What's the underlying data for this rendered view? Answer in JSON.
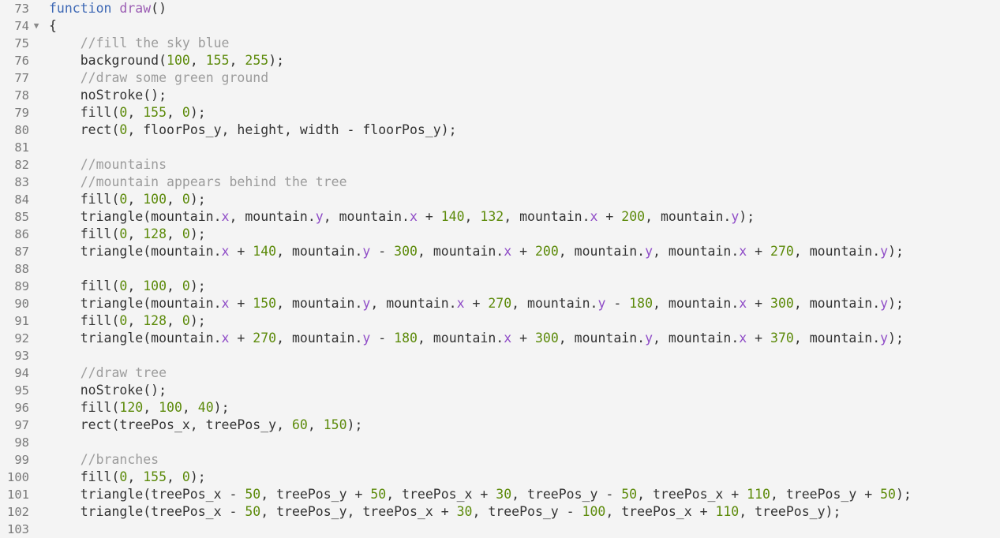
{
  "editor": {
    "fold_marker": "▼",
    "lines": [
      {
        "n": "73",
        "fold": false,
        "tokens": [
          [
            "kw",
            "function"
          ],
          [
            "plain",
            " "
          ],
          [
            "fn",
            "draw"
          ],
          [
            "plain",
            "()"
          ]
        ]
      },
      {
        "n": "74",
        "fold": true,
        "tokens": [
          [
            "plain",
            "{"
          ]
        ]
      },
      {
        "n": "75",
        "fold": false,
        "tokens": [
          [
            "plain",
            "    "
          ],
          [
            "cm",
            "//fill the sky blue"
          ]
        ]
      },
      {
        "n": "76",
        "fold": false,
        "tokens": [
          [
            "plain",
            "    background("
          ],
          [
            "num",
            "100"
          ],
          [
            "plain",
            ", "
          ],
          [
            "num",
            "155"
          ],
          [
            "plain",
            ", "
          ],
          [
            "num",
            "255"
          ],
          [
            "plain",
            ");"
          ]
        ]
      },
      {
        "n": "77",
        "fold": false,
        "tokens": [
          [
            "plain",
            "    "
          ],
          [
            "cm",
            "//draw some green ground"
          ]
        ]
      },
      {
        "n": "78",
        "fold": false,
        "tokens": [
          [
            "plain",
            "    noStroke();"
          ]
        ]
      },
      {
        "n": "79",
        "fold": false,
        "tokens": [
          [
            "plain",
            "    fill("
          ],
          [
            "num",
            "0"
          ],
          [
            "plain",
            ", "
          ],
          [
            "num",
            "155"
          ],
          [
            "plain",
            ", "
          ],
          [
            "num",
            "0"
          ],
          [
            "plain",
            ");"
          ]
        ]
      },
      {
        "n": "80",
        "fold": false,
        "tokens": [
          [
            "plain",
            "    rect("
          ],
          [
            "num",
            "0"
          ],
          [
            "plain",
            ", floorPos_y, height, width - floorPos_y);"
          ]
        ]
      },
      {
        "n": "81",
        "fold": false,
        "tokens": []
      },
      {
        "n": "82",
        "fold": false,
        "tokens": [
          [
            "plain",
            "    "
          ],
          [
            "cm",
            "//mountains"
          ]
        ]
      },
      {
        "n": "83",
        "fold": false,
        "tokens": [
          [
            "plain",
            "    "
          ],
          [
            "cm",
            "//mountain appears behind the tree"
          ]
        ]
      },
      {
        "n": "84",
        "fold": false,
        "tokens": [
          [
            "plain",
            "    fill("
          ],
          [
            "num",
            "0"
          ],
          [
            "plain",
            ", "
          ],
          [
            "num",
            "100"
          ],
          [
            "plain",
            ", "
          ],
          [
            "num",
            "0"
          ],
          [
            "plain",
            ");"
          ]
        ]
      },
      {
        "n": "85",
        "fold": false,
        "tokens": [
          [
            "plain",
            "    triangle(mountain."
          ],
          [
            "prop",
            "x"
          ],
          [
            "plain",
            ", mountain."
          ],
          [
            "prop",
            "y"
          ],
          [
            "plain",
            ", mountain."
          ],
          [
            "prop",
            "x"
          ],
          [
            "plain",
            " + "
          ],
          [
            "num",
            "140"
          ],
          [
            "plain",
            ", "
          ],
          [
            "num",
            "132"
          ],
          [
            "plain",
            ", mountain."
          ],
          [
            "prop",
            "x"
          ],
          [
            "plain",
            " + "
          ],
          [
            "num",
            "200"
          ],
          [
            "plain",
            ", mountain."
          ],
          [
            "prop",
            "y"
          ],
          [
            "plain",
            ");"
          ]
        ]
      },
      {
        "n": "86",
        "fold": false,
        "tokens": [
          [
            "plain",
            "    fill("
          ],
          [
            "num",
            "0"
          ],
          [
            "plain",
            ", "
          ],
          [
            "num",
            "128"
          ],
          [
            "plain",
            ", "
          ],
          [
            "num",
            "0"
          ],
          [
            "plain",
            ");"
          ]
        ]
      },
      {
        "n": "87",
        "fold": false,
        "tokens": [
          [
            "plain",
            "    triangle(mountain."
          ],
          [
            "prop",
            "x"
          ],
          [
            "plain",
            " + "
          ],
          [
            "num",
            "140"
          ],
          [
            "plain",
            ", mountain."
          ],
          [
            "prop",
            "y"
          ],
          [
            "plain",
            " - "
          ],
          [
            "num",
            "300"
          ],
          [
            "plain",
            ", mountain."
          ],
          [
            "prop",
            "x"
          ],
          [
            "plain",
            " + "
          ],
          [
            "num",
            "200"
          ],
          [
            "plain",
            ", mountain."
          ],
          [
            "prop",
            "y"
          ],
          [
            "plain",
            ", mountain."
          ],
          [
            "prop",
            "x"
          ],
          [
            "plain",
            " + "
          ],
          [
            "num",
            "270"
          ],
          [
            "plain",
            ", mountain."
          ],
          [
            "prop",
            "y"
          ],
          [
            "plain",
            ");"
          ]
        ]
      },
      {
        "n": "88",
        "fold": false,
        "tokens": []
      },
      {
        "n": "89",
        "fold": false,
        "tokens": [
          [
            "plain",
            "    fill("
          ],
          [
            "num",
            "0"
          ],
          [
            "plain",
            ", "
          ],
          [
            "num",
            "100"
          ],
          [
            "plain",
            ", "
          ],
          [
            "num",
            "0"
          ],
          [
            "plain",
            ");"
          ]
        ]
      },
      {
        "n": "90",
        "fold": false,
        "tokens": [
          [
            "plain",
            "    triangle(mountain."
          ],
          [
            "prop",
            "x"
          ],
          [
            "plain",
            " + "
          ],
          [
            "num",
            "150"
          ],
          [
            "plain",
            ", mountain."
          ],
          [
            "prop",
            "y"
          ],
          [
            "plain",
            ", mountain."
          ],
          [
            "prop",
            "x"
          ],
          [
            "plain",
            " + "
          ],
          [
            "num",
            "270"
          ],
          [
            "plain",
            ", mountain."
          ],
          [
            "prop",
            "y"
          ],
          [
            "plain",
            " - "
          ],
          [
            "num",
            "180"
          ],
          [
            "plain",
            ", mountain."
          ],
          [
            "prop",
            "x"
          ],
          [
            "plain",
            " + "
          ],
          [
            "num",
            "300"
          ],
          [
            "plain",
            ", mountain."
          ],
          [
            "prop",
            "y"
          ],
          [
            "plain",
            ");"
          ]
        ]
      },
      {
        "n": "91",
        "fold": false,
        "tokens": [
          [
            "plain",
            "    fill("
          ],
          [
            "num",
            "0"
          ],
          [
            "plain",
            ", "
          ],
          [
            "num",
            "128"
          ],
          [
            "plain",
            ", "
          ],
          [
            "num",
            "0"
          ],
          [
            "plain",
            ");"
          ]
        ]
      },
      {
        "n": "92",
        "fold": false,
        "tokens": [
          [
            "plain",
            "    triangle(mountain."
          ],
          [
            "prop",
            "x"
          ],
          [
            "plain",
            " + "
          ],
          [
            "num",
            "270"
          ],
          [
            "plain",
            ", mountain."
          ],
          [
            "prop",
            "y"
          ],
          [
            "plain",
            " - "
          ],
          [
            "num",
            "180"
          ],
          [
            "plain",
            ", mountain."
          ],
          [
            "prop",
            "x"
          ],
          [
            "plain",
            " + "
          ],
          [
            "num",
            "300"
          ],
          [
            "plain",
            ", mountain."
          ],
          [
            "prop",
            "y"
          ],
          [
            "plain",
            ", mountain."
          ],
          [
            "prop",
            "x"
          ],
          [
            "plain",
            " + "
          ],
          [
            "num",
            "370"
          ],
          [
            "plain",
            ", mountain."
          ],
          [
            "prop",
            "y"
          ],
          [
            "plain",
            ");"
          ]
        ]
      },
      {
        "n": "93",
        "fold": false,
        "tokens": []
      },
      {
        "n": "94",
        "fold": false,
        "tokens": [
          [
            "plain",
            "    "
          ],
          [
            "cm",
            "//draw tree"
          ]
        ]
      },
      {
        "n": "95",
        "fold": false,
        "tokens": [
          [
            "plain",
            "    noStroke();"
          ]
        ]
      },
      {
        "n": "96",
        "fold": false,
        "tokens": [
          [
            "plain",
            "    fill("
          ],
          [
            "num",
            "120"
          ],
          [
            "plain",
            ", "
          ],
          [
            "num",
            "100"
          ],
          [
            "plain",
            ", "
          ],
          [
            "num",
            "40"
          ],
          [
            "plain",
            ");"
          ]
        ]
      },
      {
        "n": "97",
        "fold": false,
        "tokens": [
          [
            "plain",
            "    rect(treePos_x, treePos_y, "
          ],
          [
            "num",
            "60"
          ],
          [
            "plain",
            ", "
          ],
          [
            "num",
            "150"
          ],
          [
            "plain",
            ");"
          ]
        ]
      },
      {
        "n": "98",
        "fold": false,
        "tokens": []
      },
      {
        "n": "99",
        "fold": false,
        "tokens": [
          [
            "plain",
            "    "
          ],
          [
            "cm",
            "//branches"
          ]
        ]
      },
      {
        "n": "100",
        "fold": false,
        "tokens": [
          [
            "plain",
            "    fill("
          ],
          [
            "num",
            "0"
          ],
          [
            "plain",
            ", "
          ],
          [
            "num",
            "155"
          ],
          [
            "plain",
            ", "
          ],
          [
            "num",
            "0"
          ],
          [
            "plain",
            ");"
          ]
        ]
      },
      {
        "n": "101",
        "fold": false,
        "tokens": [
          [
            "plain",
            "    triangle(treePos_x - "
          ],
          [
            "num",
            "50"
          ],
          [
            "plain",
            ", treePos_y + "
          ],
          [
            "num",
            "50"
          ],
          [
            "plain",
            ", treePos_x + "
          ],
          [
            "num",
            "30"
          ],
          [
            "plain",
            ", treePos_y - "
          ],
          [
            "num",
            "50"
          ],
          [
            "plain",
            ", treePos_x + "
          ],
          [
            "num",
            "110"
          ],
          [
            "plain",
            ", treePos_y + "
          ],
          [
            "num",
            "50"
          ],
          [
            "plain",
            ");"
          ]
        ]
      },
      {
        "n": "102",
        "fold": false,
        "tokens": [
          [
            "plain",
            "    triangle(treePos_x - "
          ],
          [
            "num",
            "50"
          ],
          [
            "plain",
            ", treePos_y, treePos_x + "
          ],
          [
            "num",
            "30"
          ],
          [
            "plain",
            ", treePos_y - "
          ],
          [
            "num",
            "100"
          ],
          [
            "plain",
            ", treePos_x + "
          ],
          [
            "num",
            "110"
          ],
          [
            "plain",
            ", treePos_y);"
          ]
        ]
      },
      {
        "n": "103",
        "fold": false,
        "tokens": []
      }
    ]
  }
}
